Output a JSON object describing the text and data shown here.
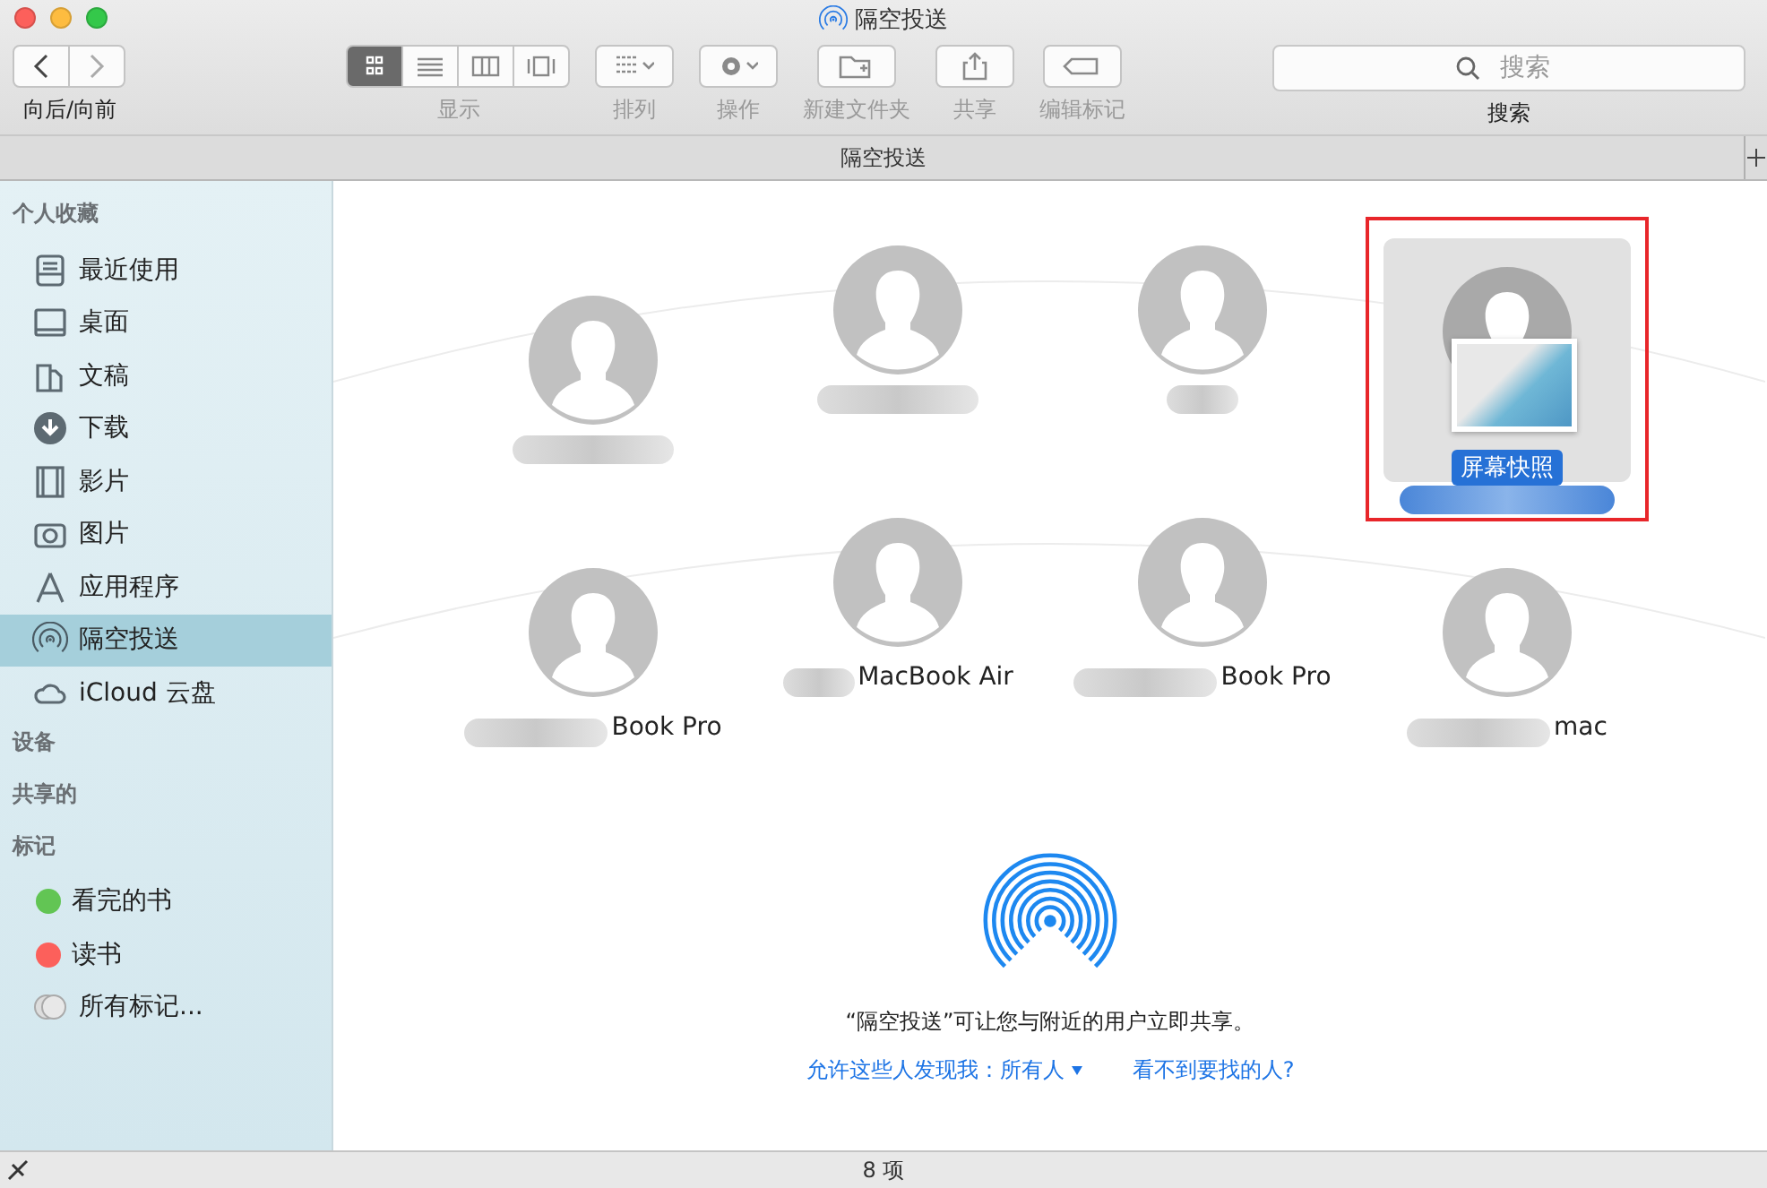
{
  "window": {
    "title": "隔空投送"
  },
  "toolbar": {
    "nav_label": "向后/向前",
    "view_modes": [
      {
        "kind": "icons",
        "selected": true
      },
      {
        "kind": "list",
        "selected": false
      },
      {
        "kind": "columns",
        "selected": false
      },
      {
        "kind": "cover",
        "selected": false
      }
    ],
    "view_label": "显示",
    "buttons": [
      {
        "kind": "arrange",
        "label": "排列"
      },
      {
        "kind": "action",
        "label": "操作"
      },
      {
        "kind": "folder",
        "label": "新建文件夹"
      },
      {
        "kind": "share",
        "label": "共享"
      },
      {
        "kind": "tag",
        "label": "编辑标记"
      }
    ],
    "search": {
      "placeholder": "搜索",
      "label": "搜索"
    }
  },
  "tab_bar": {
    "title": "隔空投送"
  },
  "sidebar": {
    "sections": [
      {
        "title": "个人收藏",
        "items": [
          {
            "kind": "recents",
            "label": "最近使用",
            "selected": false
          },
          {
            "kind": "desktop",
            "label": "桌面",
            "selected": false
          },
          {
            "kind": "documents",
            "label": "文稿",
            "selected": false
          },
          {
            "kind": "downloads",
            "label": "下载",
            "selected": false
          },
          {
            "kind": "movies",
            "label": "影片",
            "selected": false
          },
          {
            "kind": "pictures",
            "label": "图片",
            "selected": false
          },
          {
            "kind": "apps",
            "label": "应用程序",
            "selected": false
          },
          {
            "kind": "airdrop",
            "label": "隔空投送",
            "selected": true
          },
          {
            "kind": "cloud",
            "label": "iCloud 云盘",
            "selected": false
          }
        ]
      },
      {
        "title": "设备"
      },
      {
        "title": "共享的"
      },
      {
        "title": "标记",
        "items": [
          {
            "kind": "tag",
            "label": "看完的书",
            "color": "#62c554",
            "selected": false
          },
          {
            "kind": "tag",
            "label": "读书",
            "color": "#fc605b",
            "selected": false
          },
          {
            "kind": "all-tags",
            "label": "所有标记...",
            "selected": false
          }
        ]
      }
    ]
  },
  "devices": [
    {
      "selected": false
    },
    {
      "selected": false
    },
    {
      "selected": false
    },
    {
      "selected": true,
      "badge": "屏幕快照"
    },
    {
      "selected": false,
      "name": "Book Pro"
    },
    {
      "selected": false,
      "name": "MacBook Air"
    },
    {
      "selected": false,
      "name": "Book Pro"
    },
    {
      "selected": false,
      "name": "mac"
    }
  ],
  "info": {
    "message": "“隔空投送”可让您与附近的用户立即共享。",
    "discover_label": "允许这些人发现我：所有人",
    "help_link": "看不到要找的人?"
  },
  "status_bar": {
    "count": "8 项"
  }
}
